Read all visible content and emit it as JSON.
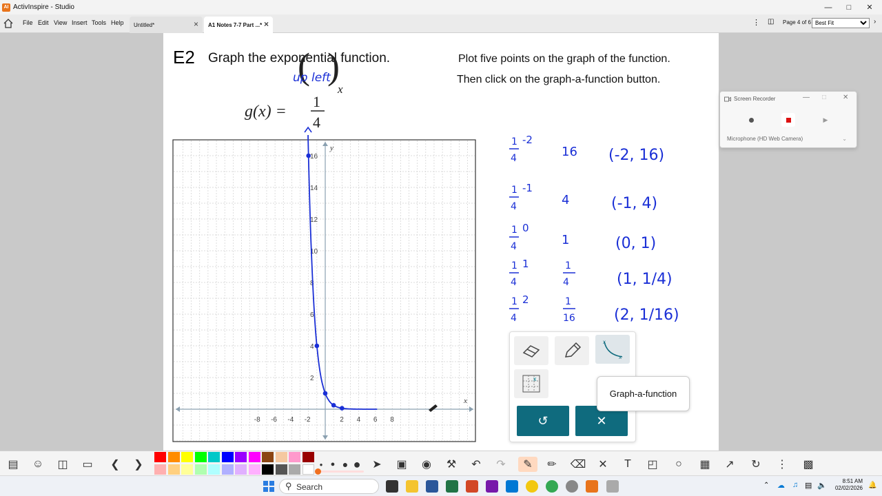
{
  "window": {
    "title": "ActivInspire - Studio"
  },
  "menu": {
    "items": [
      "File",
      "Edit",
      "View",
      "Insert",
      "Tools",
      "Help"
    ],
    "tabs": [
      {
        "label": "Untitled*",
        "active": false
      },
      {
        "label": "A1 Notes 7-7 Part ...*",
        "active": true
      }
    ],
    "page_indicator": "Page 4 of 6",
    "zoom": "Best Fit"
  },
  "slide": {
    "problem_id": "E2",
    "heading": "Graph the exponential function.",
    "instruction_line1": "Plot five points on the graph of the function.",
    "instruction_line2": "Then click on the graph-a-function button.",
    "function_lhs": "g(x) =",
    "fraction_numerator": "1",
    "fraction_denominator": "4",
    "exponent": "x",
    "handwritten_note": "up left",
    "graph": {
      "x_label": "x",
      "y_label": "y",
      "x_ticks": [
        "-8",
        "-6",
        "-4",
        "-2",
        "2",
        "4",
        "6",
        "8"
      ],
      "y_ticks": [
        "2",
        "4",
        "6",
        "8",
        "10",
        "12",
        "14",
        "16"
      ]
    },
    "handwritten_table": [
      {
        "expr": "1/4 ^ -2",
        "value": "16",
        "point": "(-2, 16)"
      },
      {
        "expr": "1/4 ^ -1",
        "value": "4",
        "point": "(-1, 4)"
      },
      {
        "expr": "1/4 ^ 0",
        "value": "1",
        "point": "(0, 1)"
      },
      {
        "expr": "1/4 ^ 1",
        "value": "1/4",
        "point": "(1, 1/4)"
      },
      {
        "expr": "1/4 ^ 2",
        "value": "1/16",
        "point": "(2, 1/16)"
      }
    ]
  },
  "recorder": {
    "title": "Screen Recorder",
    "microphone": "Microphone (HD Web Camera)"
  },
  "tools_popup": {
    "tooltip": "Graph-a-function",
    "undo_icon": "undo-icon",
    "close_icon": "close-icon"
  },
  "palette": [
    "#ff0000",
    "#ff8c00",
    "#ffff00",
    "#00ff00",
    "#00c8c8",
    "#0000ff",
    "#9900ff",
    "#ff00ff",
    "#8b4513",
    "#f5c8a0",
    "#ff99cc",
    "#990000",
    "#ffb0b0",
    "#ffd080",
    "#ffff99",
    "#b0ffb0",
    "#b0ffff",
    "#b0b0ff",
    "#e0b0ff",
    "#ffb0ff",
    "#000000",
    "#555555",
    "#aaaaaa",
    "#ffffff"
  ],
  "taskbar": {
    "search_placeholder": "Search",
    "time": "8:51 AM",
    "date": "02/02/2026"
  }
}
